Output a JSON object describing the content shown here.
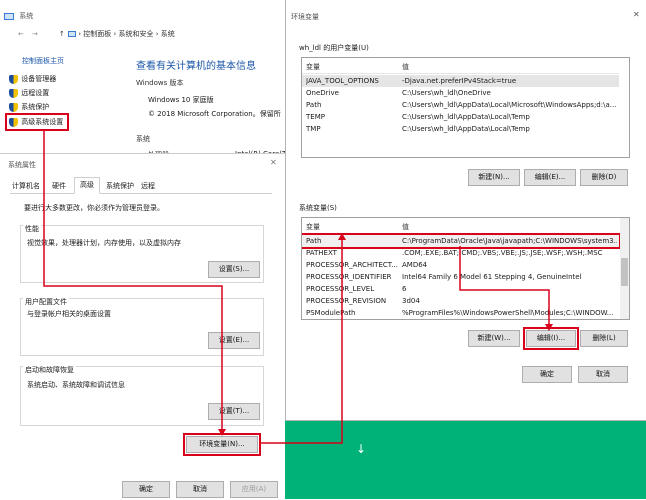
{
  "system_window": {
    "title": "系统",
    "nav": {
      "back": "←",
      "forward": "→",
      "up": "↑",
      "breadcrumb": [
        "控制面板",
        "系统和安全",
        "系统"
      ]
    },
    "sidebar": {
      "home": "控制面板主页",
      "items": [
        "设备管理器",
        "远程设置",
        "系统保护",
        "高级系统设置"
      ]
    },
    "main": {
      "heading": "查看有关计算机的基本信息",
      "edition_label": "Windows 版本",
      "edition": "Windows 10 家庭版",
      "copyright": "© 2018 Microsoft Corporation。保留所",
      "system_label": "系统",
      "processor_label": "处理器:",
      "processor_value": "Intel(R) Core(T"
    }
  },
  "system_properties": {
    "title": "系统属性",
    "tabs": [
      "计算机名",
      "硬件",
      "高级",
      "系统保护",
      "远程"
    ],
    "admin_note": "要进行大多数更改，你必须作为管理员登录。",
    "performance": {
      "title": "性能",
      "desc": "视觉效果，处理器计划，内存使用，以及虚拟内存",
      "button": "设置(S)..."
    },
    "user_profiles": {
      "title": "用户配置文件",
      "desc": "与登录帐户相关的桌面设置",
      "button": "设置(E)..."
    },
    "startup_recovery": {
      "title": "启动和故障恢复",
      "desc": "系统启动、系统故障和调试信息",
      "button": "设置(T)..."
    },
    "env_button": "环境变量(N)...",
    "ok": "确定",
    "cancel": "取消",
    "apply": "应用(A)"
  },
  "env_dialog": {
    "title": "环境变量",
    "close": "✕",
    "user_group_title": "wh_ldl 的用户变量(U)",
    "col_var": "变量",
    "col_val": "值",
    "user_vars": [
      {
        "name": "JAVA_TOOL_OPTIONS",
        "value": "-Djava.net.preferIPv4Stack=true"
      },
      {
        "name": "OneDrive",
        "value": "C:\\Users\\wh_ldl\\OneDrive"
      },
      {
        "name": "Path",
        "value": "C:\\Users\\wh_ldl\\AppData\\Local\\Microsoft\\WindowsApps;d:\\a..."
      },
      {
        "name": "TEMP",
        "value": "C:\\Users\\wh_ldl\\AppData\\Local\\Temp"
      },
      {
        "name": "TMP",
        "value": "C:\\Users\\wh_ldl\\AppData\\Local\\Temp"
      }
    ],
    "user_buttons": {
      "new": "新建(N)...",
      "edit": "编辑(E)...",
      "delete": "删除(D)"
    },
    "sys_group_title": "系统变量(S)",
    "sys_vars": [
      {
        "name": "Path",
        "value": "C:\\ProgramData\\Oracle\\Java\\javapath;C:\\WINDOWS\\system3..."
      },
      {
        "name": "PATHEXT",
        "value": ".COM;.EXE;.BAT;.CMD;.VBS;.VBE;.JS;.JSE;.WSF;.WSH;.MSC"
      },
      {
        "name": "PROCESSOR_ARCHITECT...",
        "value": "AMD64"
      },
      {
        "name": "PROCESSOR_IDENTIFIER",
        "value": "Intel64 Family 6 Model 61 Stepping 4, GenuineIntel"
      },
      {
        "name": "PROCESSOR_LEVEL",
        "value": "6"
      },
      {
        "name": "PROCESSOR_REVISION",
        "value": "3d04"
      },
      {
        "name": "PSModulePath",
        "value": "%ProgramFiles%\\WindowsPowerShell\\Modules;C:\\WINDOW..."
      }
    ],
    "sys_buttons": {
      "new": "新建(W)...",
      "edit": "编辑(I)...",
      "delete": "删除(L)"
    },
    "ok": "确定",
    "cancel": "取消"
  },
  "colors": {
    "accent": "#0078d7",
    "highlight": "#d9001b",
    "green": "#00b277",
    "link": "#1a56a8"
  },
  "icons": {
    "shield": "shield-icon",
    "monitor": "monitor-icon",
    "down_arrow": "↓"
  }
}
